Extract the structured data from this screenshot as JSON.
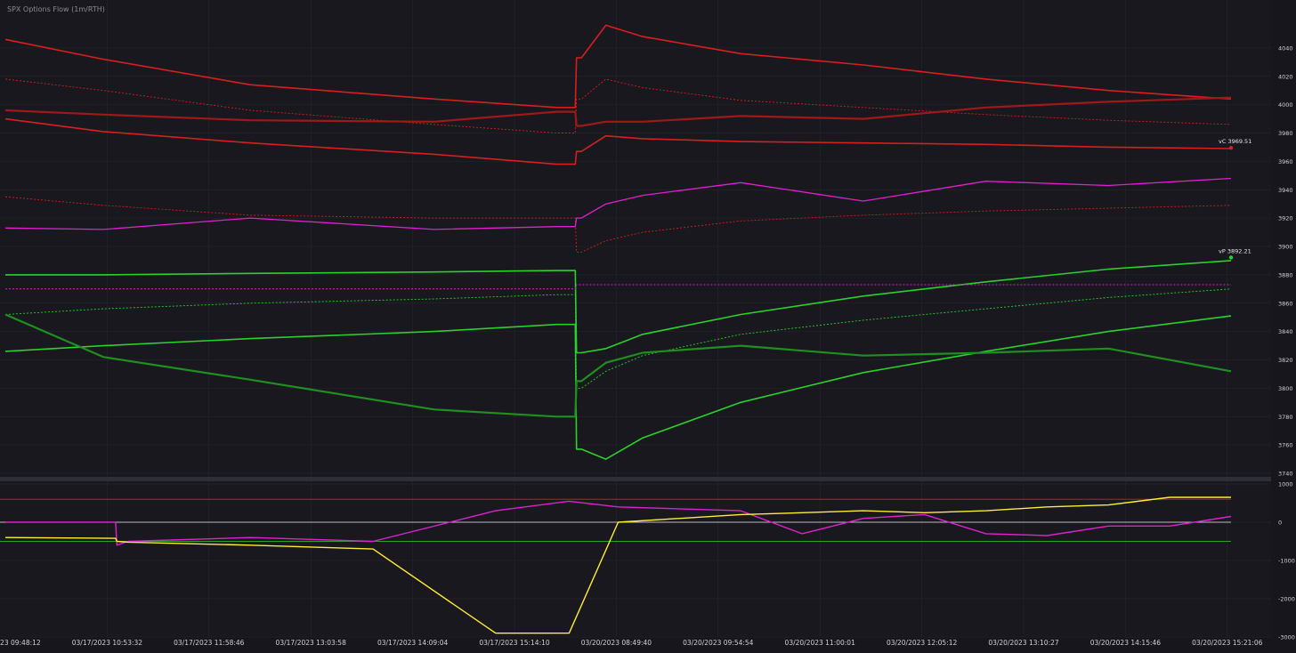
{
  "header": {
    "title": "SPX Options Flow (1m/RTH)"
  },
  "colors": {
    "background": "#16161c",
    "panel_bg": "#18181e",
    "grid": "#26262e",
    "axis_text": "#d0d0d6",
    "divider": "#3a3a46",
    "red": "#d81f1f",
    "dark_red": "#a01818",
    "green": "#2bd12b",
    "dark_green": "#1f8f1f",
    "magenta": "#e020d0",
    "cyan": "#3fd8e8",
    "yellow": "#ffee33",
    "white": "#f0f0f0"
  },
  "chart_data": [
    {
      "panel": "main",
      "type": "line",
      "title": "SPX Options Flow (1m/RTH)",
      "ylim": [
        3740,
        4060
      ],
      "yticks": [
        3740,
        3760,
        3780,
        3800,
        3820,
        3840,
        3860,
        3880,
        3900,
        3920,
        3940,
        3960,
        3980,
        4000,
        4020,
        4040
      ],
      "grid": true,
      "x_tick_labels": [
        "03/17/2023 09:48:12",
        "03/17/2023 10:53:32",
        "03/17/2023 11:58:46",
        "03/17/2023 13:03:58",
        "03/17/2023 14:09:04",
        "03/17/2023 15:14:10",
        "03/20/2023 08:49:40",
        "03/20/2023 09:54:54",
        "03/20/2023 11:00:01",
        "03/20/2023 12:05:12",
        "03/20/2023 13:10:27",
        "03/20/2023 14:15:46",
        "03/20/2023 15:21:06"
      ],
      "x": [
        0.0,
        0.08,
        0.2,
        0.35,
        0.45,
        0.465,
        0.466,
        0.47,
        0.49,
        0.52,
        0.6,
        0.7,
        0.8,
        0.9,
        1.0
      ],
      "x_format": "fraction of session span",
      "series": [
        {
          "color": "red",
          "style": "solid",
          "width": 1.6,
          "values": [
            4046,
            4032,
            4014,
            4004,
            3998,
            3998,
            4033,
            4033,
            4056,
            4048,
            4036,
            4028,
            4018,
            4010,
            4004
          ]
        },
        {
          "color": "red",
          "style": "dotted",
          "width": 0.9,
          "values": [
            4018,
            4010,
            3996,
            3986,
            3980,
            3980,
            4004,
            4004,
            4018,
            4012,
            4003,
            3998,
            3993,
            3989,
            3986
          ]
        },
        {
          "color": "dark_red",
          "style": "solid",
          "width": 2.2,
          "values": [
            3996,
            3993,
            3989,
            3988,
            3995,
            3995,
            3985,
            3985,
            3988,
            3988,
            3992,
            3990,
            3998,
            4002,
            4005
          ]
        },
        {
          "color": "red",
          "style": "solid",
          "width": 1.6,
          "values": [
            3990,
            3981,
            3973,
            3965,
            3958,
            3958,
            3967,
            3967,
            3978,
            3976,
            3974,
            3973,
            3972,
            3970,
            3969
          ]
        },
        {
          "color": "red",
          "style": "dotted",
          "width": 0.9,
          "values": [
            3935,
            3929,
            3922,
            3920,
            3920,
            3920,
            3896,
            3896,
            3904,
            3910,
            3918,
            3922,
            3925,
            3927,
            3929
          ]
        },
        {
          "color": "magenta",
          "style": "solid",
          "width": 1.3,
          "values": [
            3913,
            3912,
            3920,
            3912,
            3914,
            3914,
            3920,
            3920,
            3930,
            3936,
            3945,
            3932,
            3946,
            3943,
            3948
          ]
        },
        {
          "color": "green",
          "style": "solid",
          "width": 1.6,
          "values": [
            3880,
            3880,
            3881,
            3882,
            3883,
            3883,
            3825,
            3825,
            3828,
            3838,
            3852,
            3865,
            3875,
            3884,
            3890
          ]
        },
        {
          "color": "magenta",
          "style": "dotted",
          "width": 1.0,
          "values": [
            3870,
            3870,
            3870,
            3870,
            3870,
            3870,
            3873,
            3873,
            3873,
            3873,
            3873,
            3873,
            3873,
            3873,
            3873
          ]
        },
        {
          "color": "green",
          "style": "dotted",
          "width": 0.9,
          "values": [
            3852,
            3856,
            3860,
            3863,
            3866,
            3866,
            3800,
            3800,
            3812,
            3823,
            3838,
            3848,
            3856,
            3864,
            3870
          ]
        },
        {
          "color": "green",
          "style": "solid",
          "width": 1.6,
          "values": [
            3826,
            3830,
            3835,
            3840,
            3845,
            3845,
            3757,
            3757,
            3750,
            3765,
            3790,
            3811,
            3826,
            3840,
            3851
          ]
        },
        {
          "color": "dark_green",
          "style": "solid",
          "width": 2.2,
          "values": [
            3852,
            3822,
            3806,
            3785,
            3780,
            3780,
            3805,
            3805,
            3818,
            3825,
            3830,
            3823,
            3825,
            3828,
            3812
          ]
        }
      ],
      "value_labels": [
        {
          "text": "vC 3969.51",
          "value": 3969.51,
          "color": "red"
        },
        {
          "text": "vP 3892.21",
          "value": 3892.21,
          "color": "green"
        }
      ]
    },
    {
      "panel": "lower",
      "type": "line",
      "ylim": [
        -3000,
        1000
      ],
      "yticks": [
        -3000,
        -2000,
        -1000,
        0,
        1000
      ],
      "reference_lines": [
        {
          "value": 600,
          "color": "red"
        },
        {
          "value": 0,
          "color": "white"
        },
        {
          "value": -500,
          "color": "green"
        }
      ],
      "x": [
        0.0,
        0.09,
        0.091,
        0.1,
        0.2,
        0.3,
        0.4,
        0.46,
        0.5,
        0.6,
        0.65,
        0.7,
        0.75,
        0.8,
        0.85,
        0.9,
        0.95,
        1.0
      ],
      "series": [
        {
          "color": "magenta",
          "values": [
            0,
            0,
            -600,
            -500,
            -400,
            -500,
            300,
            550,
            400,
            300,
            -300,
            100,
            200,
            -300,
            -350,
            -100,
            -100,
            150
          ]
        },
        {
          "color": "yellow",
          "values": [
            -400,
            -420,
            -500,
            -520,
            -600,
            -700,
            -2900,
            -2900,
            0,
            200,
            250,
            300,
            250,
            300,
            400,
            450,
            650,
            650
          ]
        }
      ]
    }
  ]
}
